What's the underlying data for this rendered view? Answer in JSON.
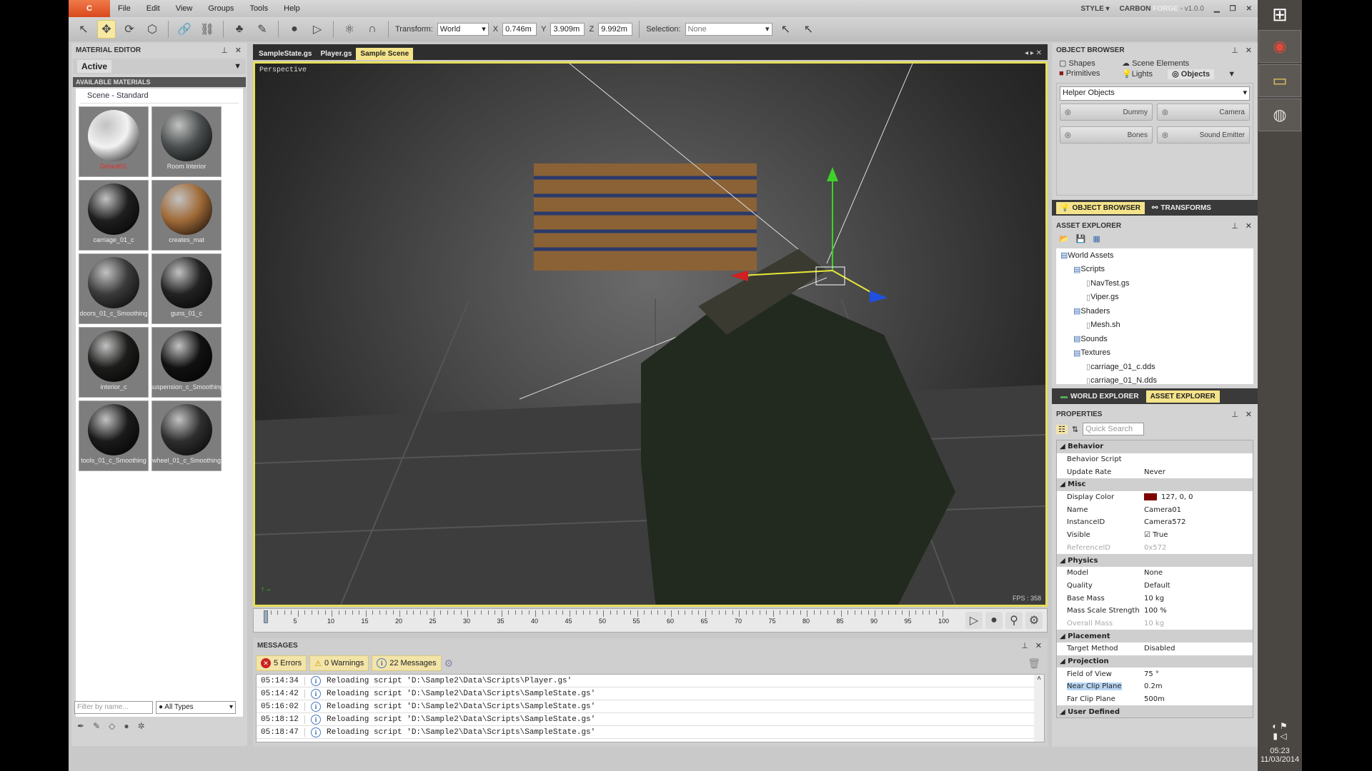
{
  "menubar": {
    "logo": "C",
    "items": [
      "File",
      "Edit",
      "View",
      "Groups",
      "Tools",
      "Help"
    ],
    "style_label": "STYLE",
    "app_name": "CARBON",
    "app_name2": "FORGE",
    "version": "- v1.0.0"
  },
  "toolbar": {
    "transform_label": "Transform:",
    "transform_value": "World",
    "x_label": "X",
    "x": "0.746m",
    "y_label": "Y",
    "y": "3.909m",
    "z_label": "Z",
    "z": "9.992m",
    "selection_label": "Selection:",
    "selection_value": "None"
  },
  "material_editor": {
    "title": "MATERIAL EDITOR",
    "active_tab": "Active",
    "section": "AVAILABLE MATERIALS",
    "group": "Scene - Standard",
    "materials": [
      {
        "name": "Default01",
        "color": "#f2f2f2"
      },
      {
        "name": "Room Interior",
        "color": "#4a4e4e"
      },
      {
        "name": "carriage_01_c",
        "color": "#1e1e1e"
      },
      {
        "name": "creates_mat",
        "color": "#a06a38"
      },
      {
        "name": "doors_01_c_Smoothing",
        "color": "#3a3a3a"
      },
      {
        "name": "guns_01_c",
        "color": "#222"
      },
      {
        "name": "interior_c",
        "color": "#1c1c1a"
      },
      {
        "name": "suspension_c_Smoothing",
        "color": "#111"
      },
      {
        "name": "tools_01_c_Smoothing",
        "color": "#1a1a1a"
      },
      {
        "name": "wheel_01_c_Smoothing",
        "color": "#2e2e2e"
      }
    ],
    "filter_placeholder": "Filter by name...",
    "type_filter": "All Types"
  },
  "viewport": {
    "tabs": [
      "SampleState.gs",
      "Player.gs",
      "Sample Scene"
    ],
    "active_tab": 2,
    "view_label": "Perspective",
    "fps": "FPS : 358"
  },
  "timeline": {
    "ticks": [
      "5",
      "10",
      "15",
      "20",
      "25",
      "30",
      "35",
      "40",
      "45",
      "50",
      "55",
      "60",
      "65",
      "70",
      "75",
      "80",
      "85",
      "90",
      "95",
      "100"
    ],
    "current_frame": 0
  },
  "messages": {
    "title": "MESSAGES",
    "errors": "5 Errors",
    "warnings": "0 Warnings",
    "messages": "22 Messages",
    "rows": [
      {
        "time": "05:14:34",
        "text": "Reloading script 'D:\\Sample2\\Data\\Scripts\\Player.gs'"
      },
      {
        "time": "05:14:42",
        "text": "Reloading script 'D:\\Sample2\\Data\\Scripts\\SampleState.gs'"
      },
      {
        "time": "05:16:02",
        "text": "Reloading script 'D:\\Sample2\\Data\\Scripts\\SampleState.gs'"
      },
      {
        "time": "05:18:12",
        "text": "Reloading script 'D:\\Sample2\\Data\\Scripts\\SampleState.gs'"
      },
      {
        "time": "05:18:47",
        "text": "Reloading script 'D:\\Sample2\\Data\\Scripts\\SampleState.gs'"
      }
    ]
  },
  "object_browser": {
    "title": "OBJECT BROWSER",
    "tabs": [
      "Shapes",
      "Scene Elements",
      "Primitives",
      "Lights",
      "Objects"
    ],
    "category": "Helper Objects",
    "buttons": [
      "Dummy",
      "Camera",
      "Bones",
      "Sound Emitter"
    ],
    "bottom_tabs": [
      "OBJECT BROWSER",
      "TRANSFORMS"
    ]
  },
  "asset_explorer": {
    "title": "ASSET EXPLORER",
    "tree": [
      {
        "label": "World Assets",
        "level": 0
      },
      {
        "label": "Scripts",
        "level": 1
      },
      {
        "label": "NavTest.gs",
        "level": 2
      },
      {
        "label": "Viper.gs",
        "level": 2
      },
      {
        "label": "Shaders",
        "level": 1
      },
      {
        "label": "Mesh.sh",
        "level": 2
      },
      {
        "label": "Sounds",
        "level": 1
      },
      {
        "label": "Textures",
        "level": 1
      },
      {
        "label": "carriage_01_c.dds",
        "level": 2
      },
      {
        "label": "carriage_01_N.dds",
        "level": 2
      }
    ],
    "bottom_tabs": [
      "WORLD EXPLORER",
      "ASSET EXPLORER"
    ]
  },
  "properties": {
    "title": "PROPERTIES",
    "search_placeholder": "Quick Search",
    "display_color": "#7f0000",
    "rows": [
      {
        "k": "Behavior",
        "cat": true
      },
      {
        "k": "Behavior Script",
        "v": ""
      },
      {
        "k": "Update Rate",
        "v": "Never"
      },
      {
        "k": "Misc",
        "cat": true
      },
      {
        "k": "Display Color",
        "v": "127, 0, 0"
      },
      {
        "k": "Name",
        "v": "Camera01"
      },
      {
        "k": "InstanceID",
        "v": "Camera572"
      },
      {
        "k": "Visible",
        "v": "True"
      },
      {
        "k": "ReferenceID",
        "v": "0x572",
        "dis": true
      },
      {
        "k": "Physics",
        "cat": true
      },
      {
        "k": "Model",
        "v": "None"
      },
      {
        "k": "Quality",
        "v": "Default"
      },
      {
        "k": "Base Mass",
        "v": "10 kg"
      },
      {
        "k": "Mass Scale Strength",
        "v": "100 %"
      },
      {
        "k": "Overall Mass",
        "v": "10 kg",
        "dis": true
      },
      {
        "k": "Placement",
        "cat": true
      },
      {
        "k": "Target Method",
        "v": "Disabled"
      },
      {
        "k": "Projection",
        "cat": true
      },
      {
        "k": "Field of View",
        "v": "75 °"
      },
      {
        "k": "Near Clip Plane",
        "v": "0.2m",
        "sel": true
      },
      {
        "k": "Far Clip Plane",
        "v": "500m"
      },
      {
        "k": "User Defined",
        "cat": true
      }
    ]
  },
  "taskbar": {
    "time": "05:23",
    "date": "11/03/2014"
  }
}
